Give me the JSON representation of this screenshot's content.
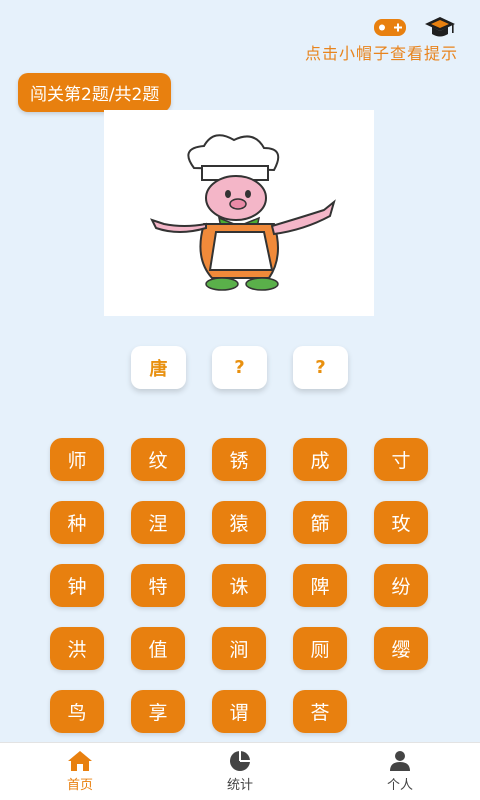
{
  "header": {
    "hint_text": "点击小帽子查看提示",
    "icons": [
      "gamepad-icon",
      "graduation-cap-icon"
    ]
  },
  "level": {
    "label": "闯关第2题/共2题"
  },
  "puzzle": {
    "image": "chef-cartoon-illustration"
  },
  "answer": {
    "slots": [
      "唐",
      "?",
      "?"
    ]
  },
  "choices": [
    "师",
    "纹",
    "锈",
    "成",
    "寸",
    "种",
    "涅",
    "猿",
    "篩",
    "玫",
    "钟",
    "特",
    "诛",
    "陴",
    "纷",
    "洪",
    "值",
    "涧",
    "厕",
    "缨",
    "鸟",
    "享",
    "谓",
    "荅"
  ],
  "tabbar": {
    "tabs": [
      {
        "label": "首页",
        "icon": "home-icon",
        "active": true
      },
      {
        "label": "统计",
        "icon": "pie-chart-icon",
        "active": false
      },
      {
        "label": "个人",
        "icon": "user-icon",
        "active": false
      }
    ]
  },
  "colors": {
    "accent": "#e8800f",
    "background": "#e6f1fb",
    "slot_text": "#e8900f"
  }
}
